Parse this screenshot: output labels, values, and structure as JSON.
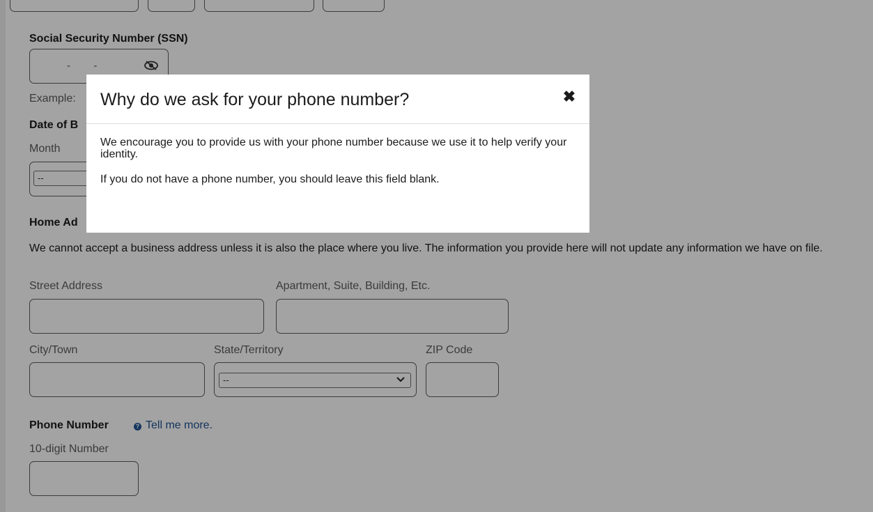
{
  "form": {
    "ssn": {
      "label": "Social Security Number (SSN)",
      "mask": "-        -",
      "example_prefix": "Example:"
    },
    "dob": {
      "label_partial": "Date of B",
      "month_label": "Month",
      "month_value": "--"
    },
    "home_address": {
      "label_partial": "Home Ad",
      "description": "We cannot accept a business address unless it is also the place where you live. The information you provide here will not update any information we have on file.",
      "street_label": "Street Address",
      "apartment_label": "Apartment, Suite, Building, Etc.",
      "city_label": "City/Town",
      "state_label": "State/Territory",
      "state_value": "--",
      "zip_label": "ZIP Code"
    },
    "phone": {
      "label": "Phone Number",
      "help_link": "Tell me more.",
      "hint": "10-digit Number"
    }
  },
  "modal": {
    "title": "Why do we ask for your phone number?",
    "close_glyph": "✖",
    "paragraph1": "We encourage you to provide us with your phone number because we use it to help verify your identity.",
    "paragraph2": "If you do not have a phone number, you should leave this field blank."
  },
  "colors": {
    "overlay": "#000000",
    "link": "#205493",
    "text": "#1b1b1b"
  }
}
